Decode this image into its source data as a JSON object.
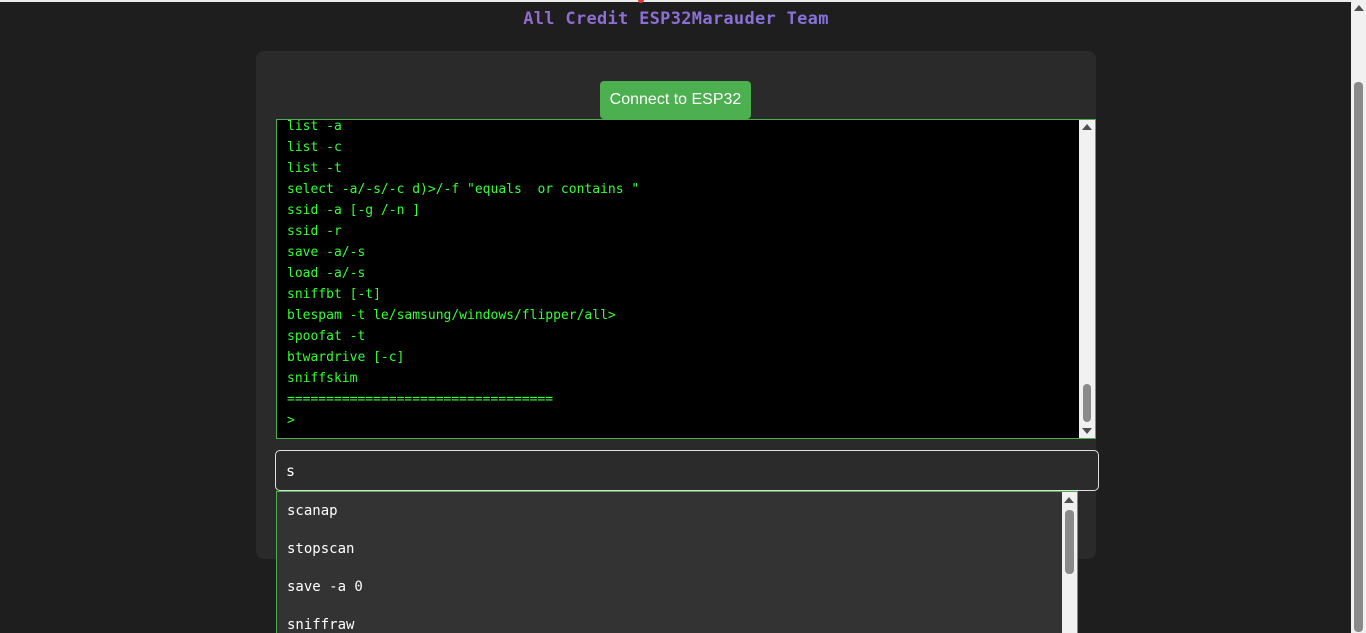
{
  "header": {
    "credit": "All Credit ESP32Marauder Team"
  },
  "controls": {
    "connect_label": "Connect to ESP32"
  },
  "terminal": {
    "lines": [
      "list -a",
      "list -c",
      "list -t",
      "select -a/-s/-c d)>/-f \"equals  or contains \"",
      "ssid -a [-g /-n ]",
      "ssid -r",
      "save -a/-s",
      "load -a/-s",
      "sniffbt [-t]",
      "blespam -t le/samsung/windows/flipper/all>",
      "spoofat -t",
      "btwardrive [-c]",
      "sniffskim",
      "==================================",
      ">"
    ]
  },
  "command_input": {
    "value": "s"
  },
  "suggestions": [
    "scanap",
    "stopscan",
    "save -a 0",
    "sniffraw"
  ],
  "colors": {
    "background": "#1e1e1e",
    "card": "#2a2a2a",
    "accent_green": "#4caf50",
    "terminal_text": "#33ff33",
    "credit_purple": "#9b59b6"
  },
  "icons": {
    "scroll_up": "triangle-up",
    "scroll_down": "triangle-down"
  }
}
